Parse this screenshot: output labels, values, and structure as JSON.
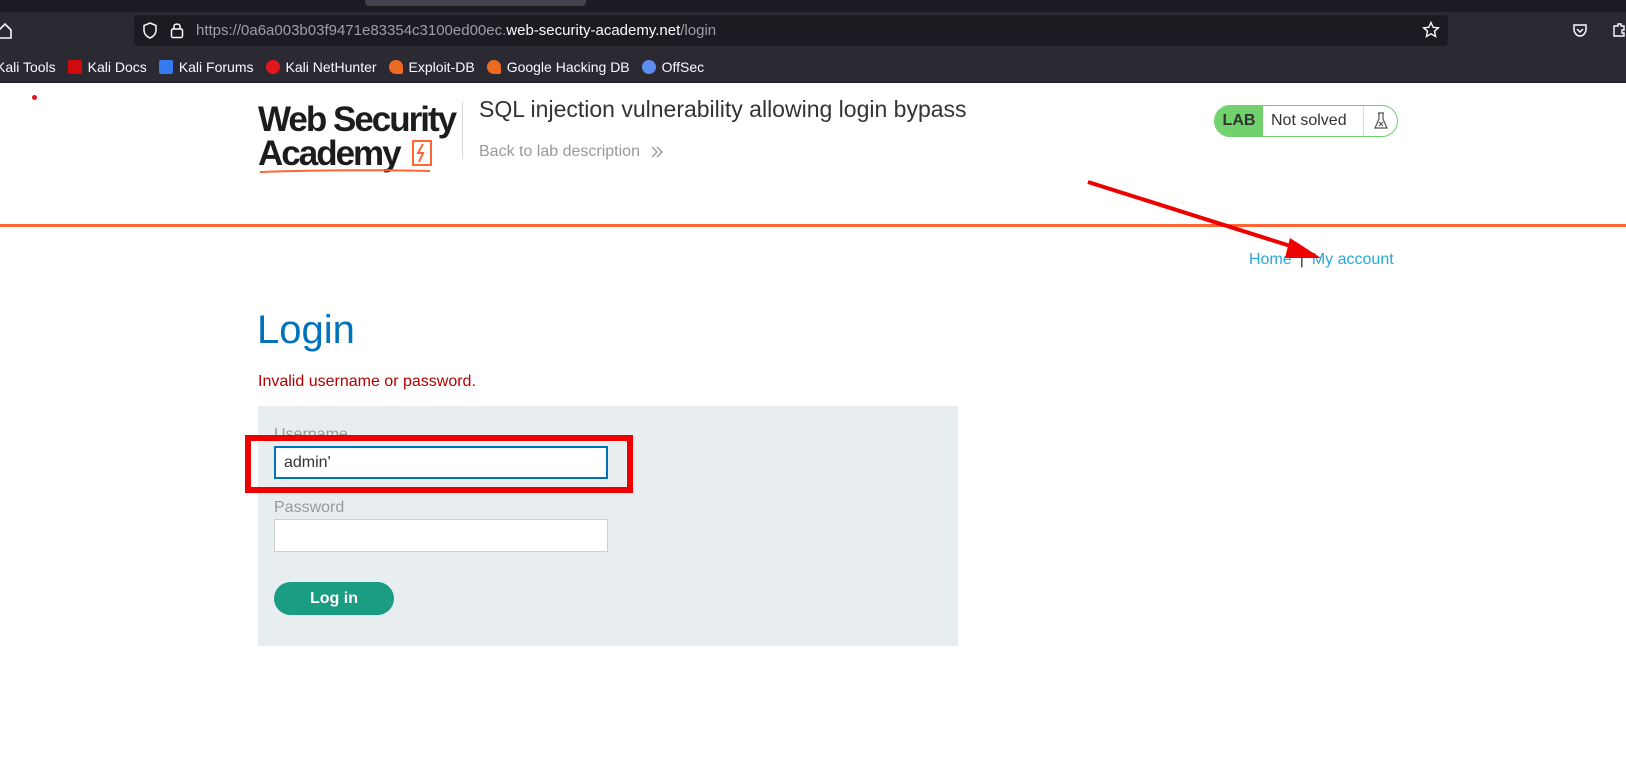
{
  "browser": {
    "url_prefix": "https://0a6a003b03f9471e83354c3100ed00ec.",
    "url_domain": "web-security-academy.net",
    "url_path": "/login",
    "bookmarks": [
      {
        "label": "Kali Tools",
        "icon": "kali-tools-icon",
        "color": "#2b2a33"
      },
      {
        "label": "Kali Docs",
        "icon": "kali-docs-icon",
        "color": "#d10b0b"
      },
      {
        "label": "Kali Forums",
        "icon": "kali-forums-icon",
        "color": "#367bf0"
      },
      {
        "label": "Kali NetHunter",
        "icon": "kali-nethunter-icon",
        "color": "#e2161d"
      },
      {
        "label": "Exploit-DB",
        "icon": "exploit-db-icon",
        "color": "#ec6b21"
      },
      {
        "label": "Google Hacking DB",
        "icon": "ghdb-icon",
        "color": "#ec6b21"
      },
      {
        "label": "OffSec",
        "icon": "offsec-icon",
        "color": "#5d8df0"
      }
    ]
  },
  "header": {
    "logo_line1": "Web Security",
    "logo_line2": "Academy",
    "lab_title": "SQL injection vulnerability allowing login bypass",
    "back_link": "Back to lab description",
    "lab_tag": "LAB",
    "lab_status": "Not solved"
  },
  "nav": {
    "home": "Home",
    "separator": "|",
    "my_account": "My account"
  },
  "login": {
    "heading": "Login",
    "error": "Invalid username or password.",
    "username_label": "Username",
    "username_value": "admin'",
    "password_label": "Password",
    "password_value": "",
    "submit_label": "Log in"
  },
  "colors": {
    "brand_orange": "#ff6633",
    "link_blue": "#29a9d8",
    "heading_blue": "#0071bc",
    "error_red": "#b50000",
    "button_green": "#1a9d82",
    "lab_green": "#70d16d",
    "annotation_red": "#ee0000"
  }
}
